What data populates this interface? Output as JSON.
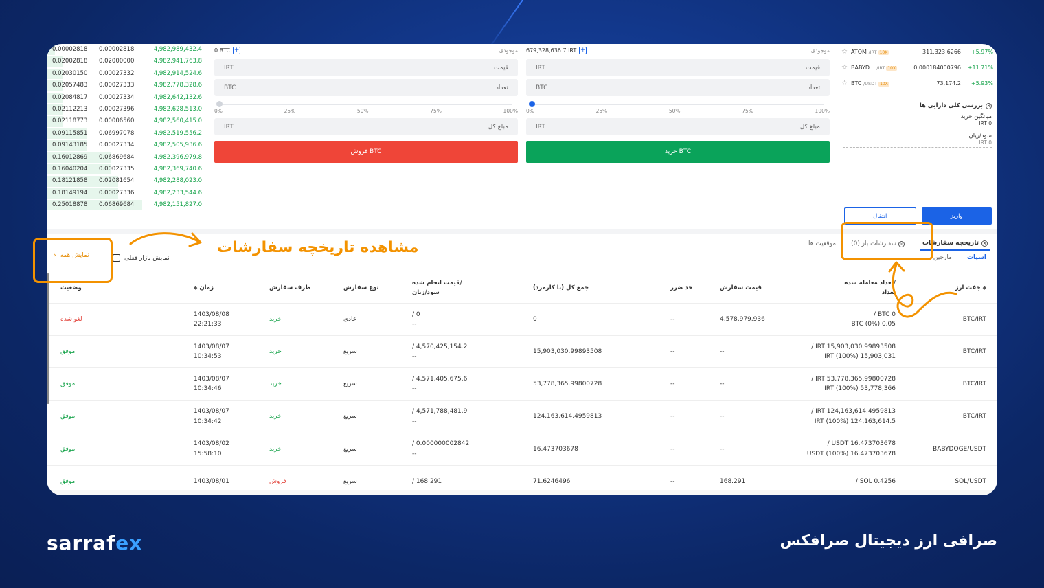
{
  "orderbook": {
    "rows": [
      {
        "a": "0.00002818",
        "b": "0.00002818",
        "c": "4,982,989,432.4",
        "d": 0.05
      },
      {
        "a": "0.02002818",
        "b": "0.02000000",
        "c": "4,982,941,763.8",
        "d": 0.1
      },
      {
        "a": "0.02030150",
        "b": "0.00027332",
        "c": "4,982,914,524.6",
        "d": 0.1
      },
      {
        "a": "0.02057483",
        "b": "0.00027333",
        "c": "4,982,778,328.6",
        "d": 0.1
      },
      {
        "a": "0.02084817",
        "b": "0.00027334",
        "c": "4,982,642,132.6",
        "d": 0.1
      },
      {
        "a": "0.02112213",
        "b": "0.00027396",
        "c": "4,982,628,513.0",
        "d": 0.1
      },
      {
        "a": "0.02118773",
        "b": "0.00006560",
        "c": "4,982,560,415.0",
        "d": 0.1
      },
      {
        "a": "0.09115851",
        "b": "0.06997078",
        "c": "4,982,519,556.2",
        "d": 0.25
      },
      {
        "a": "0.09143185",
        "b": "0.00027334",
        "c": "4,982,505,936.6",
        "d": 0.25
      },
      {
        "a": "0.16012869",
        "b": "0.06869684",
        "c": "4,982,396,979.8",
        "d": 0.4
      },
      {
        "a": "0.16040204",
        "b": "0.00027335",
        "c": "4,982,369,740.6",
        "d": 0.4
      },
      {
        "a": "0.18121858",
        "b": "0.02081654",
        "c": "4,982,288,023.0",
        "d": 0.45
      },
      {
        "a": "0.18149194",
        "b": "0.00027336",
        "c": "4,982,233,544.6",
        "d": 0.45
      },
      {
        "a": "0.25018878",
        "b": "0.06869684",
        "c": "4,982,151,827.0",
        "d": 0.6
      }
    ]
  },
  "sell_form": {
    "balance": "0 BTC",
    "balance_label": "موجودی",
    "price_unit": "IRT",
    "price_label": "قیمت",
    "qty_unit": "BTC",
    "qty_label": "تعداد",
    "ticks": [
      "0%",
      "25%",
      "50%",
      "75%",
      "100%"
    ],
    "total_unit": "IRT",
    "total_label": "مبلغ کل",
    "button": "فروش BTC"
  },
  "buy_form": {
    "balance": "679,328,636.7 IRT",
    "balance_label": "موجودی",
    "price_unit": "IRT",
    "price_label": "قیمت",
    "qty_unit": "BTC",
    "qty_label": "تعداد",
    "ticks": [
      "0%",
      "25%",
      "50%",
      "75%",
      "100%"
    ],
    "total_unit": "IRT",
    "total_label": "مبلغ کل",
    "button": "خرید BTC"
  },
  "markets": [
    {
      "sym": "ATOM",
      "quote": "/IRT",
      "lev": "10X",
      "price": "311,323.6266",
      "chg": "+5.97%"
    },
    {
      "sym": "BABYD...",
      "quote": "/IRT",
      "lev": "10X",
      "price": "0.000184000796",
      "chg": "+11.71%"
    },
    {
      "sym": "BTC",
      "quote": "/USDT",
      "lev": "10X",
      "price": "73,174.2",
      "chg": "+5.93%"
    }
  ],
  "asset": {
    "title": "بررسی کلی دارایی ها",
    "avg_label": "میانگین خرید",
    "avg_value": "0 IRT",
    "pnl_label": "سود/زیان",
    "pnl_value": "0 IRT",
    "transfer": "انتقال",
    "deposit": "واریز"
  },
  "tabs": {
    "history": "تاریخچه سفارشات",
    "open": "سفارشات باز (0)",
    "positions": "موقعیت ها",
    "spot": "اسپات",
    "margin": "مارجین",
    "show_current": "نمایش بازار فعلی",
    "show_all": "نمایش همه"
  },
  "table": {
    "headers": {
      "pair": "جفت ارز",
      "amount": "/تعداد معامله شده\nتعداد",
      "price": "قیمت سفارش",
      "stop": "حد ضرر",
      "total": "جمع کل (با کارمزد)",
      "fill": "/قیمت انجام شده\nسود/زیان",
      "type": "نوع سفارش",
      "side": "طرف سفارش",
      "time": "زمان",
      "status": "وضعیت"
    },
    "rows": [
      {
        "pair": "BTC/IRT",
        "amt1": "0 BTC /",
        "amt2": "0.05 BTC (0%)",
        "price": "4,578,979,936",
        "stop": "--",
        "total": "0",
        "fill1": "0 /",
        "fill2": "--",
        "type": "عادی",
        "side": "خرید",
        "side_kind": "buy",
        "date": "1403/08/08",
        "time": "22:21:33",
        "status": "لغو شده",
        "status_kind": "cancel"
      },
      {
        "pair": "BTC/IRT",
        "amt1": "15,903,030.99893508 IRT /",
        "amt2": "15,903,031 IRT (100%)",
        "price": "--",
        "stop": "--",
        "total": "15,903,030.99893508",
        "fill1": "4,570,425,154.2 /",
        "fill2": "--",
        "type": "سریع",
        "side": "خرید",
        "side_kind": "buy",
        "date": "1403/08/07",
        "time": "10:34:53",
        "status": "موفق",
        "status_kind": "ok"
      },
      {
        "pair": "BTC/IRT",
        "amt1": "53,778,365.99800728 IRT /",
        "amt2": "53,778,366 IRT (100%)",
        "price": "--",
        "stop": "--",
        "total": "53,778,365.99800728",
        "fill1": "4,571,405,675.6 /",
        "fill2": "--",
        "type": "سریع",
        "side": "خرید",
        "side_kind": "buy",
        "date": "1403/08/07",
        "time": "10:34:46",
        "status": "موفق",
        "status_kind": "ok"
      },
      {
        "pair": "BTC/IRT",
        "amt1": "124,163,614.4959813 IRT /",
        "amt2": "124,163,614.5 IRT (100%)",
        "price": "--",
        "stop": "--",
        "total": "124,163,614.4959813",
        "fill1": "4,571,788,481.9 /",
        "fill2": "--",
        "type": "سریع",
        "side": "خرید",
        "side_kind": "buy",
        "date": "1403/08/07",
        "time": "10:34:42",
        "status": "موفق",
        "status_kind": "ok"
      },
      {
        "pair": "BABYDOGE/USDT",
        "amt1": "16.473703678 USDT /",
        "amt2": "16.473703678 USDT (100%)",
        "price": "--",
        "stop": "--",
        "total": "16.473703678",
        "fill1": "0.000000002842 /",
        "fill2": "--",
        "type": "سریع",
        "side": "خرید",
        "side_kind": "buy",
        "date": "1403/08/02",
        "time": "15:58:10",
        "status": "موفق",
        "status_kind": "ok"
      },
      {
        "pair": "SOL/USDT",
        "amt1": "0.4256 SOL /",
        "amt2": "",
        "price": "168.291",
        "stop": "--",
        "total": "71.6246496",
        "fill1": "168.291 /",
        "fill2": "",
        "type": "سریع",
        "side": "فروش",
        "side_kind": "sell",
        "date": "1403/08/01",
        "time": "",
        "status": "موفق",
        "status_kind": "ok"
      }
    ]
  },
  "callout": "مشاهده تاریخچه سفارشات",
  "footer": {
    "logo_a": "sarraf",
    "logo_b": "ex",
    "tagline": "صرافی ارز دیجیتال صرافکس"
  },
  "colors": {
    "accent": "#1b63e6",
    "buy": "#0aa35a",
    "sell": "#ef4538",
    "highlight": "#f39200"
  }
}
